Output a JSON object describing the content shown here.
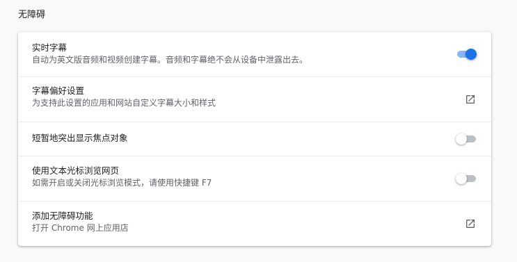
{
  "section": {
    "title": "无障碍"
  },
  "items": [
    {
      "label": "实时字幕",
      "sub": "自动为英文版音频和视频创建字幕。音频和字幕绝不会从设备中泄露出去。",
      "control": "toggle",
      "checked": true
    },
    {
      "label": "字幕偏好设置",
      "sub": "为支持此设置的应用和网站自定义字幕大小和样式",
      "control": "external-link-icon"
    },
    {
      "label": "短暂地突出显示焦点对象",
      "sub": "",
      "control": "toggle",
      "checked": false
    },
    {
      "label": "使用文本光标浏览网页",
      "sub": "如需开启或关闭光标浏览模式，请使用快捷键 F7",
      "control": "toggle",
      "checked": false
    },
    {
      "label": "添加无障碍功能",
      "sub": "打开 Chrome 网上应用店",
      "control": "external-link-icon"
    }
  ],
  "colors": {
    "accent": "#1a73e8",
    "accent_track": "#8ab4f8",
    "off_track": "#bdc1c6",
    "icon": "#5f6368"
  }
}
